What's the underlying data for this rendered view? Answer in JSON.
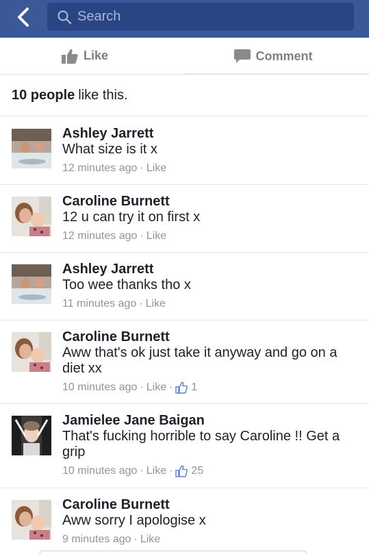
{
  "header": {
    "search_placeholder": "Search"
  },
  "actions": {
    "like_label": "Like",
    "comment_label": "Comment"
  },
  "likes_summary": {
    "count_text": "10 people",
    "suffix_text": "like this."
  },
  "comments": [
    {
      "name": "Ashley Jarrett",
      "text": "What size is it x",
      "time": "12 minutes ago",
      "like_label": "Like",
      "avatar": "hot-tub-photo"
    },
    {
      "name": "Caroline Burnett",
      "text": "12 u can try it on first x",
      "time": "12 minutes ago",
      "like_label": "Like",
      "avatar": "mother-child-photo"
    },
    {
      "name": "Ashley Jarrett",
      "text": "Too wee thanks tho x",
      "time": "11 minutes ago",
      "like_label": "Like",
      "avatar": "hot-tub-photo"
    },
    {
      "name": "Caroline Burnett",
      "text": "Aww that's ok just take it anyway and go on a diet xx",
      "time": "10 minutes ago",
      "like_label": "Like",
      "reactions": "1",
      "avatar": "mother-child-photo"
    },
    {
      "name": "Jamielee Jane Baigan",
      "text": "That's fucking horrible to say Caroline !! Get a grip",
      "time": "10 minutes ago",
      "like_label": "Like",
      "reactions": "25",
      "avatar": "car-seat-photo"
    },
    {
      "name": "Caroline Burnett",
      "text": "Aww sorry I apologise x",
      "time": "9 minutes ago",
      "like_label": "Like",
      "avatar": "mother-child-photo"
    }
  ],
  "colors": {
    "brand": "#3b5998",
    "search_bg": "#2a4584",
    "meta_grey": "#90949c"
  }
}
